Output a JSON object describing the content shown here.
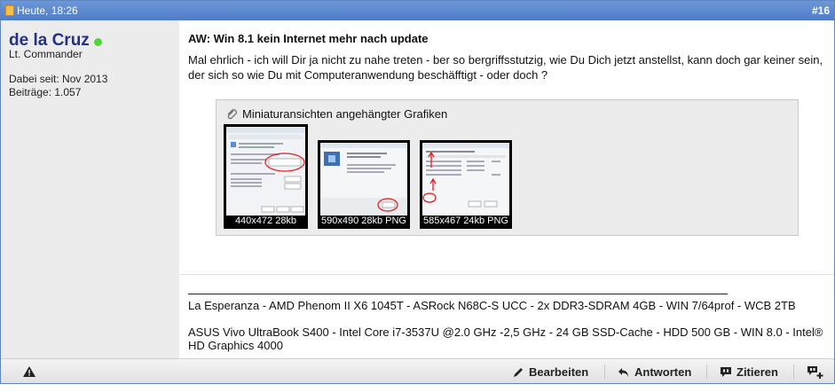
{
  "header": {
    "date": "Heute, 18:26",
    "post_number": "#16"
  },
  "user": {
    "name": "de la Cruz",
    "title": "Lt. Commander",
    "joined": "Dabei seit: Nov 2013",
    "posts": "Beiträge: 1.057",
    "online_color": "#4fd63a"
  },
  "post": {
    "title": "AW: Win 8.1 kein Internet mehr nach update",
    "message": "Mal ehrlich - ich will Dir ja nicht zu nahe treten - ber so bergriffsstutzig, wie Du Dich jetzt anstellst, kann doch gar keiner sein, der sich so wie Du mit Computeranwendung beschäfftigt - oder doch ?"
  },
  "attachments": {
    "heading": "Miniaturansichten angehängter Grafiken",
    "items": [
      {
        "caption": "440x472 28kb"
      },
      {
        "caption": "590x490 28kb PNG"
      },
      {
        "caption": "585x467 24kb PNG"
      }
    ]
  },
  "signature": {
    "line1": "La Esperanza - AMD Phenom II X6 1045T - ASRock N68C-S UCC - 2x DDR3-SDRAM 4GB - WIN 7/64prof - WCB 2TB",
    "line2": "ASUS Vivo UltraBook S400 - Intel Core i7-3537U @2.0 GHz -2,5 GHz - 24 GB SSD-Cache - HDD 500 GB - WIN 8.0 - Intel® HD Graphics 4000"
  },
  "footer": {
    "edit": "Bearbeiten",
    "reply": "Antworten",
    "quote": "Zitieren",
    "icons": [
      "warning-icon",
      "pencil-icon",
      "reply-arrow-icon",
      "quote-bubble-icon",
      "multiquote-plus-icon"
    ]
  },
  "colors": {
    "header": "#5a86cf",
    "username": "#23308c",
    "annotation": "#e02020"
  }
}
